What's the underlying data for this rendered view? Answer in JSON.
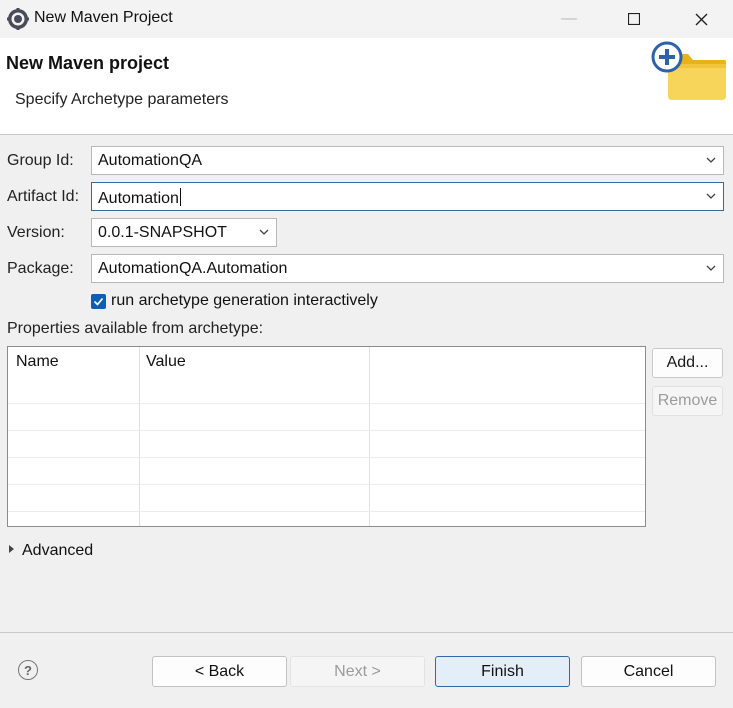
{
  "window": {
    "title": "New Maven Project"
  },
  "header": {
    "title": "New Maven project",
    "subtitle": "Specify Archetype parameters"
  },
  "form": {
    "group_id": {
      "label": "Group Id:",
      "value": "AutomationQA"
    },
    "artifact_id": {
      "label": "Artifact Id:",
      "value": "Automation"
    },
    "version": {
      "label": "Version:",
      "value": "0.0.1-SNAPSHOT"
    },
    "package": {
      "label": "Package:",
      "value": "AutomationQA.Automation"
    },
    "interactive": {
      "label": "run archetype generation interactively",
      "checked": true
    }
  },
  "properties": {
    "label": "Properties available from archetype:",
    "columns": [
      "Name",
      "Value"
    ],
    "rows": []
  },
  "side_buttons": {
    "add": "Add...",
    "remove": "Remove"
  },
  "advanced": {
    "label": "Advanced"
  },
  "footer": {
    "back": "< Back",
    "next": "Next >",
    "finish": "Finish",
    "cancel": "Cancel"
  },
  "icons": {
    "app": "eclipse-gear-icon",
    "header": "new-folder-plus-icon",
    "help": "help-icon"
  },
  "colors": {
    "accent": "#0a5fb4",
    "primary_button": "#e4eef9",
    "focus_border": "#2d6ea6"
  }
}
